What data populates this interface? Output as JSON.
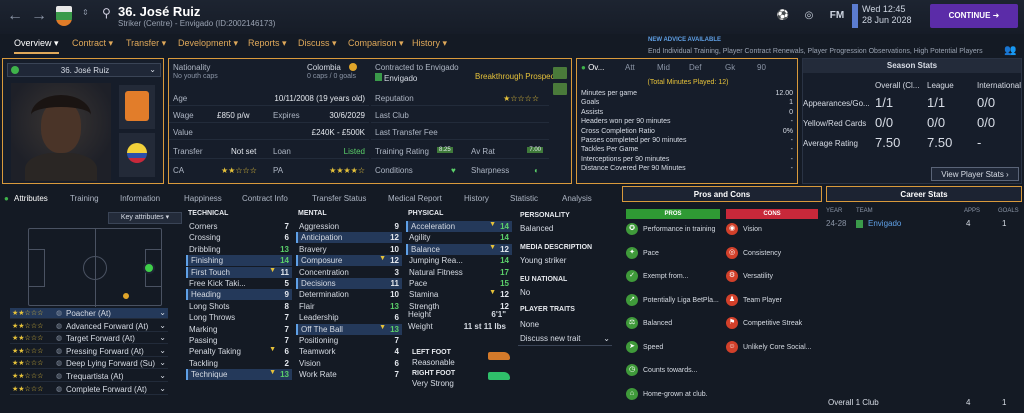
{
  "top": {
    "title": "36. José Ruiz",
    "subtitle": "Striker (Centre) - Envigado (ID:2002146173)",
    "date_line1": "Wed 12:45",
    "date_line2": "28 Jun 2028",
    "continue": "CONTINUE",
    "fm": "FM"
  },
  "tabs": [
    "Overview ▾",
    "Contract ▾",
    "Transfer ▾",
    "Development ▾",
    "Reports ▾",
    "Discuss ▾",
    "Comparison ▾",
    "History ▾"
  ],
  "advice": {
    "title": "NEW ADVICE AVAILABLE",
    "text": "End Individual Training, Player Contract Renewals, Player Progression Observations, High Potential Players"
  },
  "player_card": {
    "name": "36. José Ruiz"
  },
  "info": {
    "nationality_label": "Nationality",
    "nationality": "Colombia",
    "youth_caps": "No youth caps",
    "caps": "0 caps / 0 goals",
    "contracted_label": "Contracted to Envigado",
    "club": "Envigado",
    "breakthrough": "Breakthrough Prospect",
    "age_label": "Age",
    "age": "10/11/2008 (19 years old)",
    "reputation_label": "Reputation",
    "wage_label": "Wage",
    "wage": "£850 p/w",
    "expires_label": "Expires",
    "expires": "30/6/2029",
    "last_club_label": "Last Club",
    "value_label": "Value",
    "value": "£240K - £500K",
    "last_fee_label": "Last Transfer Fee",
    "transfer_label": "Transfer",
    "transfer": "Not set",
    "loan_label": "Loan",
    "loan": "Listed",
    "training_label": "Training Rating",
    "training": "8.25",
    "avrat_label": "Av Rat",
    "avrat": "7.00",
    "ca_label": "CA",
    "pa_label": "PA",
    "conditions_label": "Conditions",
    "sharpness_label": "Sharpness"
  },
  "stats_panel": {
    "tabs": [
      "Ov...",
      "Att",
      "Mid",
      "Def",
      "Gk",
      "90"
    ],
    "total": "(Total Minutes Played: 12)",
    "rows": [
      {
        "label": "Minutes per game",
        "value": "12.00"
      },
      {
        "label": "Goals",
        "value": "1"
      },
      {
        "label": "Assists",
        "value": "0"
      },
      {
        "label": "Headers won per 90 minutes",
        "value": "-"
      },
      {
        "label": "Cross Completion Ratio",
        "value": "0%"
      },
      {
        "label": "Passes completed per 90 minutes",
        "value": "-"
      },
      {
        "label": "Tackles Per Game",
        "value": "-"
      },
      {
        "label": "Interceptions per 90 minutes",
        "value": "-"
      },
      {
        "label": "Distance Covered Per 90 Minutes",
        "value": "-"
      }
    ]
  },
  "season_stats": {
    "title": "Season Stats",
    "cols": [
      "Overall (Cl...",
      "League",
      "International"
    ],
    "rows": [
      {
        "label": "Appearances/Go...",
        "v1": "1/1",
        "v2": "1/1",
        "v3": "0/0"
      },
      {
        "label": "Yellow/Red Cards",
        "v1": "0/0",
        "v2": "0/0",
        "v3": "0/0"
      },
      {
        "label": "Average Rating",
        "v1": "7.50",
        "v2": "7.50",
        "v3": "-"
      }
    ],
    "view_button": "View Player Stats ›"
  },
  "subtabs": [
    "Attributes",
    "Training",
    "Information",
    "Happiness",
    "Contract Info",
    "Transfer Status",
    "Medical Report",
    "History",
    "Statistic",
    "Analysis"
  ],
  "key_attributes": "Key attributes ▾",
  "technical": {
    "title": "TECHNICAL",
    "items": [
      {
        "n": "Corners",
        "v": "7"
      },
      {
        "n": "Crossing",
        "v": "6"
      },
      {
        "n": "Dribbling",
        "v": "13"
      },
      {
        "n": "Finishing",
        "v": "14"
      },
      {
        "n": "First Touch",
        "v": "11"
      },
      {
        "n": "Free Kick Taki...",
        "v": "5"
      },
      {
        "n": "Heading",
        "v": "9"
      },
      {
        "n": "Long Shots",
        "v": "8"
      },
      {
        "n": "Long Throws",
        "v": "7"
      },
      {
        "n": "Marking",
        "v": "7"
      },
      {
        "n": "Passing",
        "v": "7"
      },
      {
        "n": "Penalty Taking",
        "v": "6"
      },
      {
        "n": "Tackling",
        "v": "2"
      },
      {
        "n": "Technique",
        "v": "13"
      }
    ]
  },
  "mental": {
    "title": "MENTAL",
    "items": [
      {
        "n": "Aggression",
        "v": "9"
      },
      {
        "n": "Anticipation",
        "v": "12"
      },
      {
        "n": "Bravery",
        "v": "10"
      },
      {
        "n": "Composure",
        "v": "12"
      },
      {
        "n": "Concentration",
        "v": "3"
      },
      {
        "n": "Decisions",
        "v": "11"
      },
      {
        "n": "Determination",
        "v": "10"
      },
      {
        "n": "Flair",
        "v": "13"
      },
      {
        "n": "Leadership",
        "v": "6"
      },
      {
        "n": "Off The Ball",
        "v": "13"
      },
      {
        "n": "Positioning",
        "v": "7"
      },
      {
        "n": "Teamwork",
        "v": "4"
      },
      {
        "n": "Vision",
        "v": "6"
      },
      {
        "n": "Work Rate",
        "v": "7"
      }
    ]
  },
  "physical": {
    "title": "PHYSICAL",
    "items": [
      {
        "n": "Acceleration",
        "v": "14"
      },
      {
        "n": "Agility",
        "v": "14"
      },
      {
        "n": "Balance",
        "v": "12"
      },
      {
        "n": "Jumping Rea...",
        "v": "14"
      },
      {
        "n": "Natural Fitness",
        "v": "17"
      },
      {
        "n": "Pace",
        "v": "15"
      },
      {
        "n": "Stamina",
        "v": "12"
      },
      {
        "n": "Strength",
        "v": "12"
      }
    ],
    "height_label": "Height",
    "height": "6'1\"",
    "weight_label": "Weight",
    "weight": "11 st 11 lbs",
    "left_foot_label": "LEFT FOOT",
    "left_foot": "Reasonable",
    "right_foot_label": "RIGHT FOOT",
    "right_foot": "Very Strong"
  },
  "personality": {
    "title": "PERSONALITY",
    "value": "Balanced",
    "media_title": "MEDIA DESCRIPTION",
    "media": "Young striker",
    "eu_title": "EU NATIONAL",
    "eu": "No",
    "traits_title": "PLAYER TRAITS",
    "traits": "None",
    "discuss": "Discuss new trait"
  },
  "roles": [
    {
      "name": "Poacher (At)"
    },
    {
      "name": "Advanced Forward (At)"
    },
    {
      "name": "Target Forward (At)"
    },
    {
      "name": "Pressing Forward (At)"
    },
    {
      "name": "Deep Lying Forward (Su)"
    },
    {
      "name": "Trequartista (At)"
    },
    {
      "name": "Complete Forward (At)"
    }
  ],
  "pros_cons": {
    "title": "Pros and Cons",
    "pros_label": "PROS",
    "cons_label": "CONS",
    "pros": [
      "Performance in training",
      "Pace",
      "Exempt from...",
      "Potentially Liga BetPla...",
      "Balanced",
      "Speed",
      "Counts towards...",
      "Home-grown at club."
    ],
    "cons": [
      "Vision",
      "Consistency",
      "Versatility",
      "Team Player",
      "Competitive Streak",
      "Unlikely Core Social..."
    ]
  },
  "career": {
    "title": "Career Stats",
    "cols": [
      "YEAR",
      "TEAM",
      "APPS",
      "GOALS"
    ],
    "rows": [
      {
        "year": "24-28",
        "team": "Envigado",
        "apps": "4",
        "goals": "1"
      }
    ],
    "total_label": "Overall 1 Club",
    "total_apps": "4",
    "total_goals": "1"
  },
  "colors": {
    "accent": "#e0a95a",
    "continue": "#5b2ca8",
    "green": "#3f9a3a",
    "red": "#d2402a"
  }
}
